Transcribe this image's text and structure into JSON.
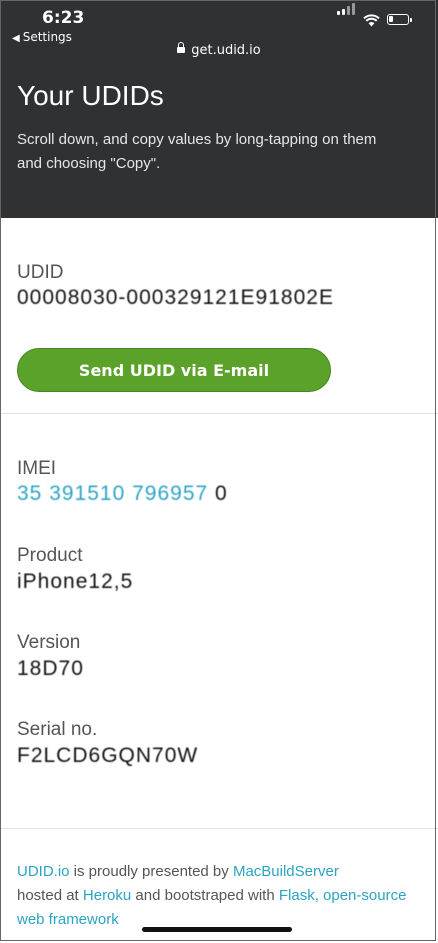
{
  "status_bar": {
    "time": "6:23",
    "back_label": "Settings"
  },
  "browser": {
    "url": "get.udid.io"
  },
  "header": {
    "title": "Your UDIDs",
    "subtitle": "Scroll down, and copy values by long-tapping on them and choosing \"Copy\"."
  },
  "udid": {
    "label": "UDID",
    "value": "00008030-000329121E91802E"
  },
  "send_button": {
    "label": "Send UDID via E-mail"
  },
  "imei": {
    "label": "IMEI",
    "value_link": "35 391510 796957",
    "value_tail": " 0"
  },
  "product": {
    "label": "Product",
    "value": "iPhone12,5"
  },
  "version": {
    "label": "Version",
    "value": "18D70"
  },
  "serial": {
    "label": "Serial no.",
    "value": "F2LCD6GQN70W"
  },
  "footer": {
    "brand_link": "UDID.io",
    "text1": " is proudly presented by ",
    "macbuild_link": "MacBuildServer",
    "text2": " hosted at ",
    "heroku_link": "Heroku",
    "text3": " and bootstraped with ",
    "flask_link": "Flask, open-source web framework"
  },
  "colors": {
    "header_bg": "#2f3133",
    "button_green": "#5aa22a",
    "link": "#2ba3c4"
  }
}
